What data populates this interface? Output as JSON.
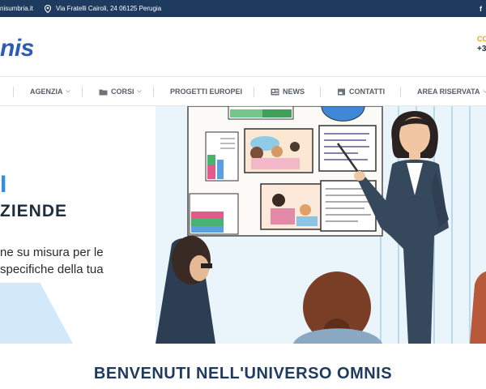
{
  "topbar": {
    "email": "nisumbria.it",
    "address": "Via Fratelli Cairoli, 24 06125 Perugia",
    "social": "f"
  },
  "header": {
    "logo": "nis",
    "contact_label": "CO",
    "contact_phone": "+3"
  },
  "nav": {
    "items": [
      {
        "label": "AGENZIA",
        "icon": "",
        "has_dropdown": true
      },
      {
        "label": "CORSI",
        "icon": "folder-icon",
        "has_dropdown": true
      },
      {
        "label": "PROGETTI EUROPEI",
        "icon": "",
        "has_dropdown": false
      },
      {
        "label": "NEWS",
        "icon": "newspaper-icon",
        "has_dropdown": false
      },
      {
        "label": "CONTATTI",
        "icon": "contact-card-icon",
        "has_dropdown": false
      },
      {
        "label": "AREA RISERVATA",
        "icon": "",
        "has_dropdown": true
      }
    ]
  },
  "hero": {
    "title_accent": "I",
    "title": "ZIENDE",
    "text_line_1": "ne su misura per le",
    "text_line_2": "specifiche della tua"
  },
  "welcome": {
    "title": "BENVENUTI NELL'UNIVERSO OMNIS"
  },
  "colors": {
    "topbar": "#1f3a5f",
    "accent": "#2f8fe0",
    "logo": "#2e5ab8",
    "contact": "#e8a21a"
  }
}
